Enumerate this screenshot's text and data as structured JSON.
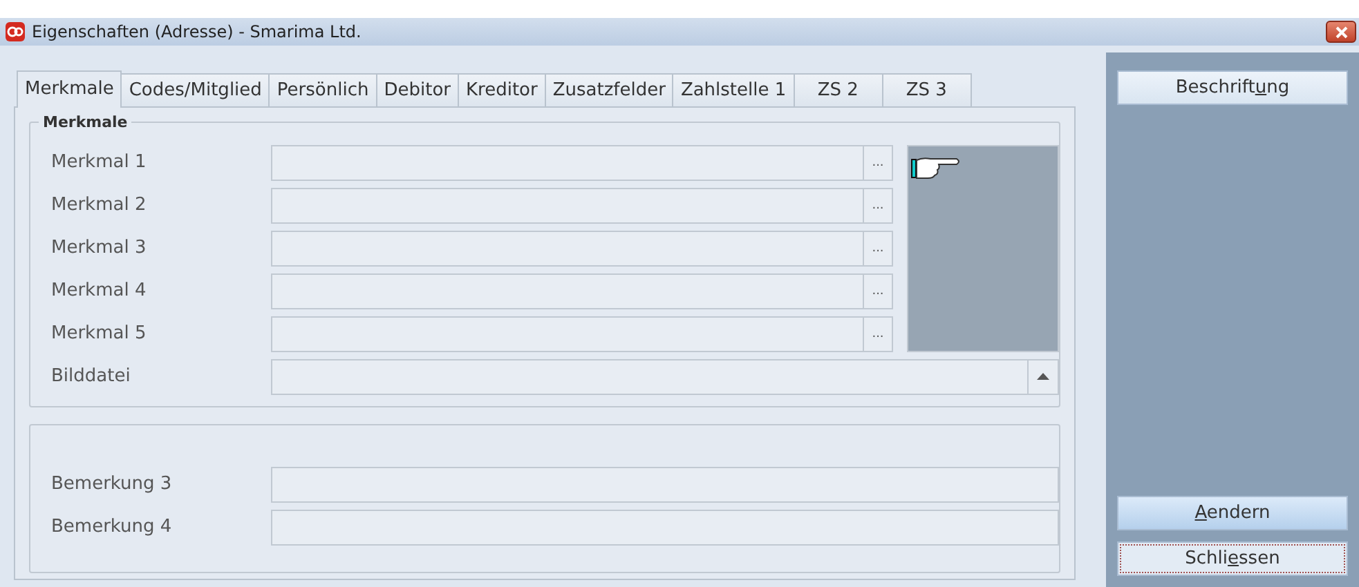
{
  "window": {
    "title": "Eigenschaften (Adresse) - Smarima Ltd."
  },
  "tabs": [
    {
      "label": "Merkmale",
      "selected": true
    },
    {
      "label": "Codes/Mitglied",
      "selected": false
    },
    {
      "label": "Persönlich",
      "selected": false
    },
    {
      "label": "Debitor",
      "selected": false
    },
    {
      "label": "Kreditor",
      "selected": false
    },
    {
      "label": "Zusatzfelder",
      "selected": false
    },
    {
      "label": "Zahlstelle 1",
      "selected": false
    },
    {
      "label": "ZS 2",
      "selected": false
    },
    {
      "label": "ZS 3",
      "selected": false
    }
  ],
  "group": {
    "title": "Merkmale",
    "fields": [
      {
        "label": "Merkmal 1",
        "browse": "..."
      },
      {
        "label": "Merkmal 2",
        "browse": "..."
      },
      {
        "label": "Merkmal 3",
        "browse": "..."
      },
      {
        "label": "Merkmal 4",
        "browse": "..."
      },
      {
        "label": "Merkmal 5",
        "browse": "..."
      }
    ],
    "image_file": {
      "label": "Bilddatei"
    }
  },
  "remarks": [
    {
      "label": "Bemerkung 3"
    },
    {
      "label": "Bemerkung 4"
    }
  ],
  "buttons": [
    {
      "before": "Beschrift",
      "key": "u",
      "after": "ng",
      "focused": false,
      "kind": "top"
    },
    {
      "key": "A",
      "after": "endern",
      "focused": false,
      "kind": "bottom"
    },
    {
      "before": "Schli",
      "key": "e",
      "after": "ssen",
      "focused": true,
      "kind": "bottom"
    }
  ]
}
